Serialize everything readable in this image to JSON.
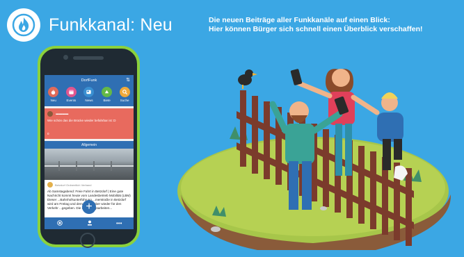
{
  "header": {
    "title": "Funkkanal: Neu",
    "description_line1": "Die neuen Beiträge aller Funkkanäle auf einen Blick:",
    "description_line2": "Hier können Bürger sich schnell einen Überblick verschaffen!"
  },
  "app": {
    "title": "DorfFunk",
    "sort_icon": "sort-icon",
    "nav": [
      {
        "label": "Neu",
        "icon": "fire-icon",
        "color": "#e06b5a"
      },
      {
        "label": "Events",
        "icon": "calendar-icon",
        "color": "#e0568f"
      },
      {
        "label": "News",
        "icon": "newspaper-icon",
        "color": "#3a8fd1"
      },
      {
        "label": "Biete",
        "icon": "hand-icon",
        "color": "#64b847"
      },
      {
        "label": "Suche",
        "icon": "search-icon",
        "color": "#f0a93b"
      }
    ],
    "card_red": {
      "message": "Wie schön das die Brücke wieder befahrbar ist :D",
      "count": "0"
    },
    "section_label": "Allgemein",
    "post": {
      "author": "Betzdorf Ordnentlich Verband",
      "text": "Ab Samstagabend: Freie Fahrt in Betzdorf | Eine gute Nachricht kommt heute vom Landesbetrieb Mobilität (LBM) Dieser ...Bahnhofsunterführung ...merstraße in Betzdorf wird am Freitag und dem 13. Oktober wieder für den Verkehr ...gegeben. Die Sanierungsarbeiten..."
    },
    "fab_label": "+",
    "tabbar": [
      "signal-icon",
      "user-pin-icon",
      "more-icon"
    ],
    "tabbar_more": "•••"
  },
  "colors": {
    "background": "#3ba7e4",
    "phone_frame": "#8bd13c",
    "app_primary": "#2f6fb3",
    "card_red": "#e86a5e"
  }
}
